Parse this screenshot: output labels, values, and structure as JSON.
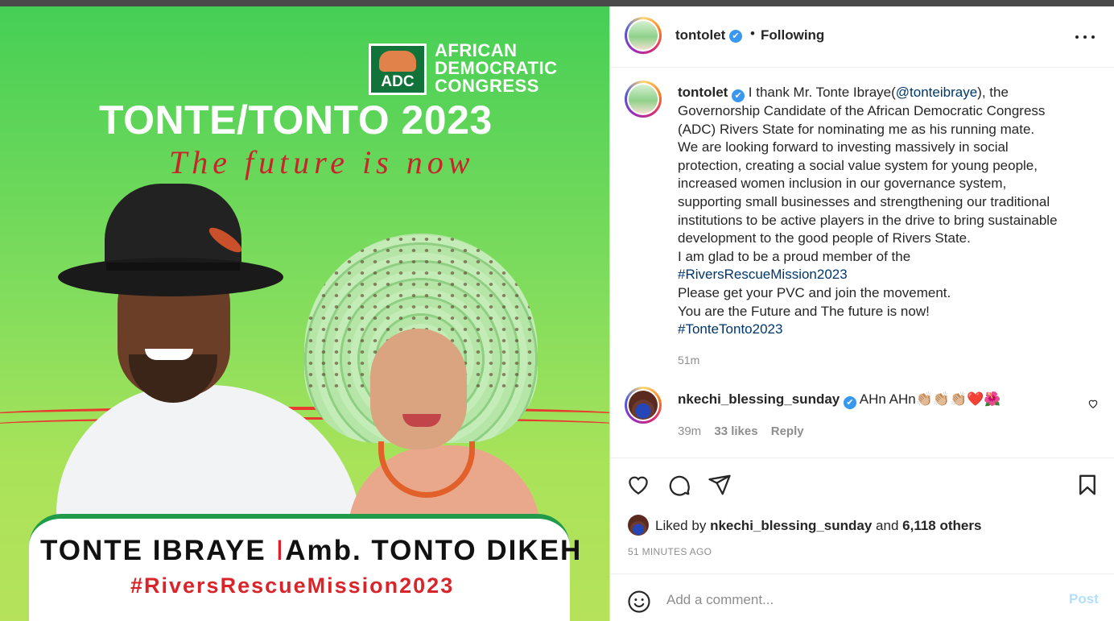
{
  "poster": {
    "logo_text": "ADC",
    "org_line1": "AFRICAN",
    "org_line2": "DEMOCRATIC",
    "org_line3": "CONGRESS",
    "headline": "TONTE/TONTO 2023",
    "tagline": "The future is now",
    "name_left": "TONTE IBRAYE",
    "name_sep": "I",
    "name_right": "Amb. TONTO DIKEH",
    "hashtag": "#RiversRescueMission2023"
  },
  "header": {
    "username": "tontolet",
    "verified_icon": "✔",
    "dot": "•",
    "follow_status": "Following"
  },
  "caption": {
    "username": "tontolet",
    "line1": "I thank Mr. Tonte Ibraye(",
    "mention": "@tonteibraye",
    "line1_end": "), the",
    "line2": "Governorship Candidate of the African Democratic Congress",
    "line3": "(ADC) Rivers State for nominating me as his running mate.",
    "line4": "We are looking forward to investing massively in social",
    "line5": "protection, creating a social value system for young people,",
    "line6": "increased women inclusion in our governance system,",
    "line7": "supporting small businesses and strengthening our traditional",
    "line8": "institutions to be active players in the drive to bring sustainable",
    "line9": "development to the good people of Rivers State.",
    "line10": "I am glad to be a proud member of the",
    "hashtag1": "#RiversRescueMission2023",
    "line11": "Please get your PVC and join the movement.",
    "line12": "You are the Future and The future is now!",
    "hashtag2": "#TonteTonto2023",
    "time": "51m"
  },
  "comment": {
    "username": "nkechi_blessing_sunday",
    "text": "AHn AHn👏🏼👏🏼👏🏼❤️🌺",
    "time": "39m",
    "likes": "33 likes",
    "reply": "Reply"
  },
  "likes": {
    "prefix": "Liked by",
    "user": "nkechi_blessing_sunday",
    "middle": "and",
    "others": "6,118 others"
  },
  "timestamp": "51 MINUTES AGO",
  "add_comment": {
    "placeholder": "Add a comment...",
    "post_label": "Post"
  },
  "colors": {
    "link": "#00376b",
    "verified": "#3897f0",
    "post_disabled": "#b2dffc",
    "poster_green": "#45cf55"
  }
}
